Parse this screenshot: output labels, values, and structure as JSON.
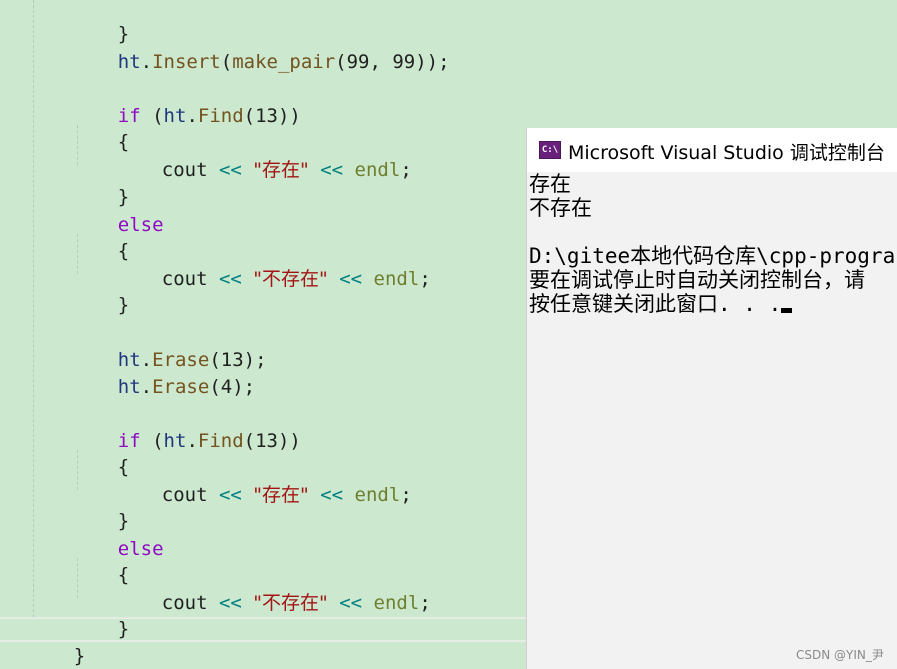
{
  "editor": {
    "lines": [
      {
        "brace": "}"
      },
      {
        "obj": "ht",
        "dot": ".",
        "fn": "Insert",
        "open": "(",
        "fn2": "make_pair",
        "args": "(99, 99));"
      },
      {
        "kw": "if",
        "cond_open": " (",
        "obj": "ht",
        "dot": ".",
        "fn": "Find",
        "args": "(13))"
      },
      {
        "brace": "{"
      },
      {
        "var": "cout",
        "op1": " << ",
        "str": "\"存在\"",
        "op2": " << ",
        "endl": "endl",
        "end": ";"
      },
      {
        "brace": "}"
      },
      {
        "kw": "else"
      },
      {
        "brace": "{"
      },
      {
        "var": "cout",
        "op1": " << ",
        "str": "\"不存在\"",
        "op2": " << ",
        "endl": "endl",
        "end": ";"
      },
      {
        "brace": "}"
      },
      {
        "obj": "ht",
        "dot": ".",
        "fn": "Erase",
        "args": "(13);"
      },
      {
        "obj": "ht",
        "dot": ".",
        "fn": "Erase",
        "args": "(4);"
      },
      {
        "kw": "if",
        "cond_open": " (",
        "obj": "ht",
        "dot": ".",
        "fn": "Find",
        "args": "(13))"
      },
      {
        "brace": "{"
      },
      {
        "var": "cout",
        "op1": " << ",
        "str": "\"存在\"",
        "op2": " << ",
        "endl": "endl",
        "end": ";"
      },
      {
        "brace": "}"
      },
      {
        "kw": "else"
      },
      {
        "brace": "{"
      },
      {
        "var": "cout",
        "op1": " << ",
        "str": "\"不存在\"",
        "op2": " << ",
        "endl": "endl",
        "end": ";"
      },
      {
        "brace": "}"
      },
      {
        "brace": "}"
      }
    ]
  },
  "console": {
    "title": "Microsoft Visual Studio 调试控制台",
    "icon_label": "C:\\",
    "output": [
      "存在",
      "不存在",
      "",
      "D:\\gitee本地代码仓库\\cpp-progra",
      "要在调试停止时自动关闭控制台，请",
      "按任意键关闭此窗口. . ."
    ]
  },
  "watermark": "CSDN @YIN_尹",
  "colors": {
    "editor_bg": "#cce8cf",
    "console_bg": "#f2f2f2",
    "keyword": "#8f08c4",
    "string": "#a31515",
    "operator": "#008080",
    "function": "#74531f",
    "object": "#1f377f"
  }
}
